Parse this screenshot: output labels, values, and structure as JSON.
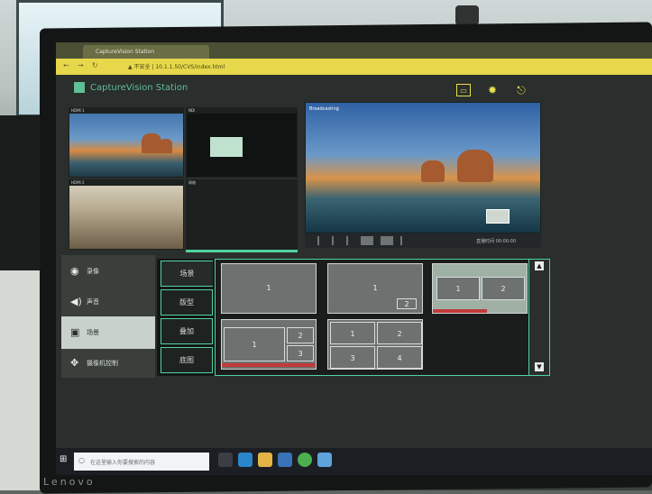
{
  "brand": {
    "text": "Lenovo"
  },
  "browser": {
    "tab_title": "CaptureVision Station",
    "address": "▲ 不安全 | 10.1.1.50/CVS/index.html",
    "icons": [
      "back-arrow-icon",
      "forward-arrow-icon",
      "reload-icon",
      "warning-icon"
    ]
  },
  "app": {
    "title": "CaptureVision Station",
    "toolbar_icons": [
      "monitor-icon",
      "gear-icon",
      "exit-door-icon"
    ],
    "accent": "#53d3a0",
    "highlight": "#e8e04a"
  },
  "previews": {
    "cam1_label": "HDMI 1",
    "cam2_label": "NDI",
    "cam3_label": "HDMI 2",
    "cam4_label": "网络",
    "big_label": "Broadcasting",
    "timer": "直播时间 00:00:00"
  },
  "nav": {
    "items": [
      {
        "label": "录像",
        "icon": "record-icon"
      },
      {
        "label": "声音",
        "icon": "speaker-icon"
      },
      {
        "label": "场景",
        "icon": "scene-icon"
      },
      {
        "label": "摄像机控制",
        "icon": "camera-control-icon"
      }
    ],
    "active": 2
  },
  "tabs": {
    "items": [
      "场景",
      "版型",
      "叠加",
      "底图"
    ],
    "active": 0
  },
  "layouts": {
    "l1": [
      "1"
    ],
    "l2": [
      "1",
      "2"
    ],
    "l3": [
      "1",
      "2"
    ],
    "l4": [
      "1",
      "2",
      "3"
    ],
    "l5": [
      "1",
      "2",
      "3",
      "4"
    ]
  },
  "taskbar": {
    "search_placeholder": "在这里输入你要搜索的内容",
    "icons": [
      "windows-start-icon",
      "task-view-icon",
      "edge-icon",
      "file-explorer-icon",
      "store-icon",
      "chrome-icon",
      "app-icon"
    ]
  }
}
